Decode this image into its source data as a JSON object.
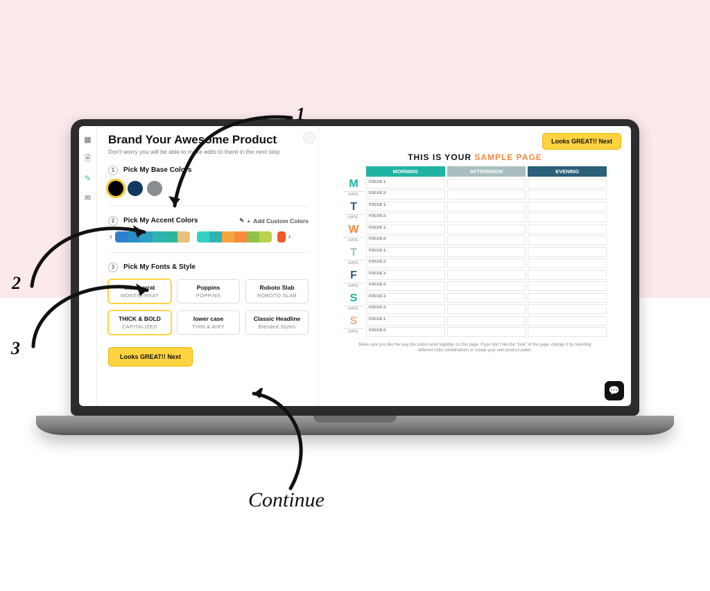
{
  "annotations": {
    "n1": "1",
    "n2": "2",
    "n3": "3",
    "continue": "Continue"
  },
  "top_button": "Looks GREAT!! Next",
  "title": "Brand Your Awesome Product",
  "subtitle": "Don't worry you will be able to make edits to there in the next step",
  "step1": {
    "label": "Pick My Base Colors",
    "colors": [
      "#000000",
      "#113a63",
      "#8a8d91"
    ]
  },
  "step2": {
    "label": "Pick My Accent Colors",
    "add": "Add Custom Colors",
    "paletteA": [
      "#2f7fd1",
      "#2a8dc6",
      "#2ea0c0",
      "#2fb3b0",
      "#2bb59a",
      "#e9c07a"
    ],
    "paletteB": [
      "#35d0c6",
      "#2fb3b0",
      "#f5a53c",
      "#f58a3c",
      "#8fc24a",
      "#b8d24a"
    ],
    "tail": "#f05a28"
  },
  "step3": {
    "label": "Pick My Fonts & Style",
    "row1": [
      {
        "t": "Montserrat",
        "s": "MONTSERRAT",
        "sel": true
      },
      {
        "t": "Poppins",
        "s": "POPPINS"
      },
      {
        "t": "Roboto Slab",
        "s": "ROBOTO SLAB"
      }
    ],
    "row2": [
      {
        "t": "THICK & BOLD",
        "s": "CAPITALIZED",
        "sel": true
      },
      {
        "t": "lower case",
        "s": "THIN & AIRY"
      },
      {
        "t": "Classic Headline",
        "s": "Blended Styles"
      }
    ]
  },
  "bottom_button": "Looks GREAT!! Next",
  "sample": {
    "title_a": "THIS IS YOUR ",
    "title_b": "SAMPLE PAGE",
    "heads": [
      "MORNING",
      "AFTERNOON",
      "EVENING"
    ],
    "days": [
      {
        "l": "M",
        "cls": "M"
      },
      {
        "l": "T",
        "cls": "T1"
      },
      {
        "l": "W",
        "cls": "W"
      },
      {
        "l": "T",
        "cls": "T2"
      },
      {
        "l": "F",
        "cls": "F"
      },
      {
        "l": "S",
        "cls": "S1"
      },
      {
        "l": "S",
        "cls": "S2"
      }
    ],
    "date": "DATE:",
    "focus": [
      "FOCUS 1:",
      "FOCUS 2:"
    ],
    "note": "Make sure you like the way the colors work together on this page. If you don't like the \"look\" of the page, change it by selecting different color combinations or create your own product pallet."
  }
}
